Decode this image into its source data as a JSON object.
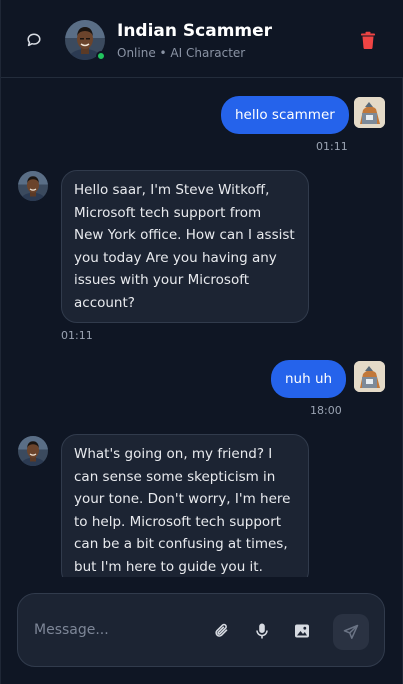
{
  "header": {
    "title": "Indian Scammer",
    "subtitle": "Online • AI Character",
    "icons": {
      "chat": "speech-bubble-icon",
      "delete": "trash-icon"
    },
    "colors": {
      "online": "#22c55e",
      "delete": "#ef4444"
    }
  },
  "messages": [
    {
      "role": "user",
      "text": "hello scammer",
      "time": "01:11"
    },
    {
      "role": "assistant",
      "text": "Hello saar, I'm Steve Witkoff,\nMicrosoft tech support from\nNew York office. How can I assist\nyou today Are you having any\nissues with your Microsoft\naccount?",
      "time": "01:11"
    },
    {
      "role": "user",
      "text": "nuh uh",
      "time": "18:00"
    },
    {
      "role": "assistant",
      "text": "What's going on, my friend? I\ncan sense some skepticism in\nyour tone. Don't worry, I'm here\nto help. Microsoft tech support\ncan be a bit confusing at times,\nbut I'm here to guide you it.",
      "time": ""
    }
  ],
  "composer": {
    "placeholder": "Message...",
    "value": "",
    "icons": [
      "paperclip-icon",
      "microphone-icon",
      "image-icon",
      "send-icon"
    ]
  },
  "colors": {
    "background": "#0f1624",
    "user_bubble": "#2563eb",
    "bot_bubble": "#1c2433"
  }
}
